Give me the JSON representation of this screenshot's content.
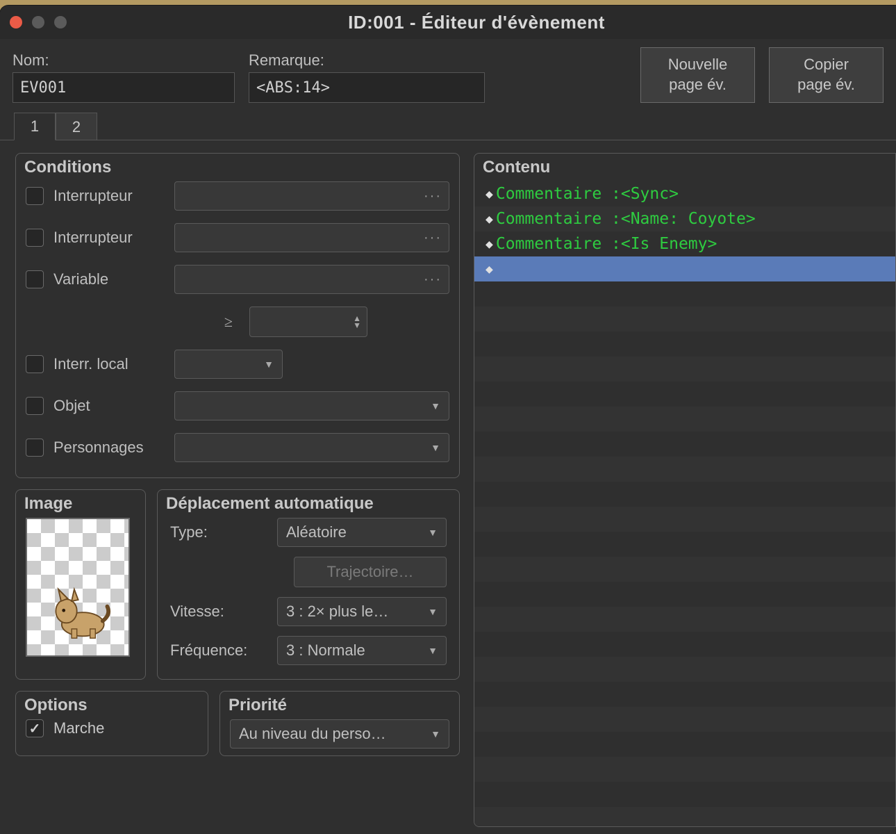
{
  "window": {
    "title": "ID:001 - Éditeur d'évènement"
  },
  "fields": {
    "nom_label": "Nom:",
    "nom_value": "EV001",
    "remarque_label": "Remarque:",
    "remarque_value": "<ABS:14>"
  },
  "buttons": {
    "new_page": "Nouvelle\npage év.",
    "copy_page": "Copier\npage év."
  },
  "tabs": [
    "1",
    "2"
  ],
  "conditions": {
    "title": "Conditions",
    "switch1": "Interrupteur",
    "switch2": "Interrupteur",
    "variable": "Variable",
    "ge_symbol": "≥",
    "self_switch": "Interr. local",
    "item": "Objet",
    "actor": "Personnages"
  },
  "image": {
    "title": "Image"
  },
  "movement": {
    "title": "Déplacement automatique",
    "type_label": "Type:",
    "type_value": "Aléatoire",
    "route_btn": "Trajectoire…",
    "speed_label": "Vitesse:",
    "speed_value": "3 : 2× plus le…",
    "freq_label": "Fréquence:",
    "freq_value": "3 : Normale"
  },
  "options": {
    "title": "Options",
    "walk": "Marche"
  },
  "priority": {
    "title": "Priorité",
    "value": "Au niveau du perso…"
  },
  "contenu": {
    "title": "Contenu",
    "lines": [
      {
        "key": "Commentaire :",
        "val": "<Sync>"
      },
      {
        "key": "Commentaire :",
        "val": "<Name: Coyote>"
      },
      {
        "key": "Commentaire :",
        "val": "<Is Enemy>"
      }
    ]
  }
}
